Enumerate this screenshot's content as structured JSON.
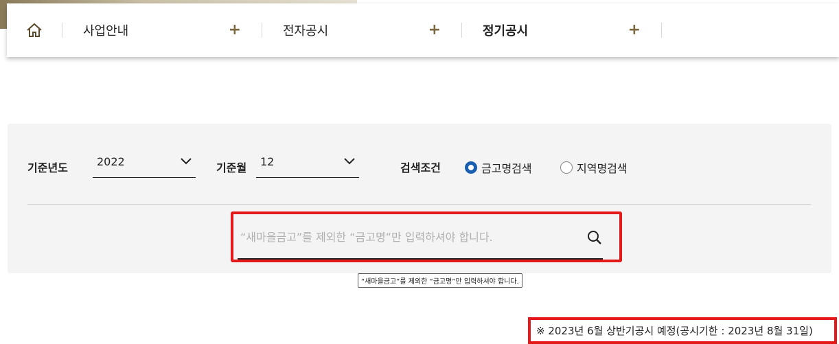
{
  "nav": {
    "home_icon": "home-icon",
    "items": [
      {
        "label": "사업안내",
        "plus": "+"
      },
      {
        "label": "전자공시",
        "plus": "+"
      },
      {
        "label": "정기공시",
        "plus": "+"
      }
    ]
  },
  "filters": {
    "year_label": "기준년도",
    "year_value": "2022",
    "month_label": "기준월",
    "month_value": "12",
    "condition_label": "검색조건",
    "radio_name": "금고명검색",
    "radio_region": "지역명검색",
    "selected": "금고명검색"
  },
  "search": {
    "placeholder": "“새마을금고”를 제외한 “금고명”만 입력하셔야 합니다.",
    "tooltip": "“새마을금고”를 제외한 “금고명”만 입력하셔야 합니다."
  },
  "notice": "※ 2023년 6월 상반기공시 예정(공시기한 : 2023년 8월 31일)",
  "colors": {
    "accent": "#1a5fb0",
    "highlight": "#e41a1a",
    "plus": "#7a6840"
  }
}
